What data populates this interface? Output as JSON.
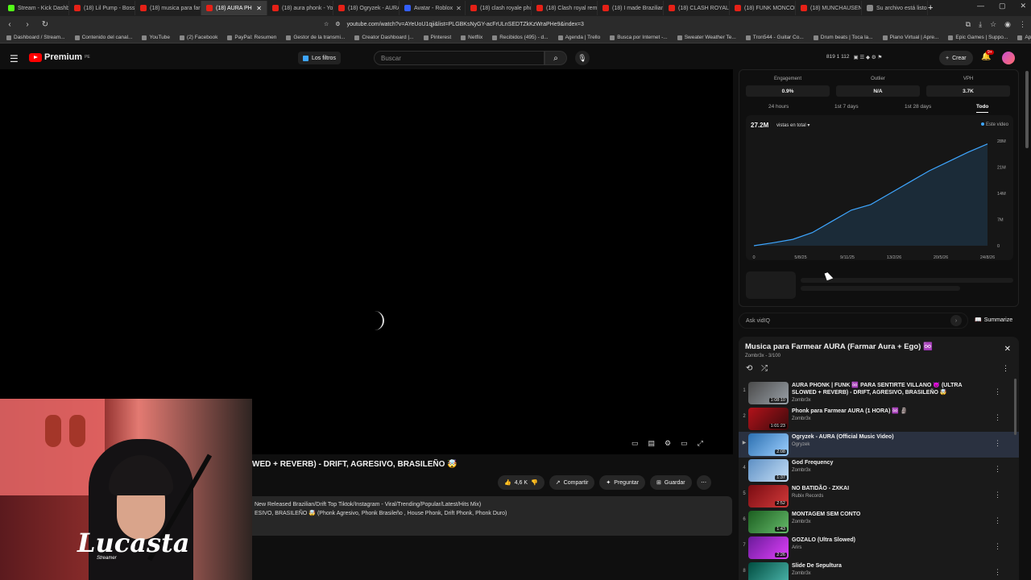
{
  "browser": {
    "tabs": [
      {
        "label": "Stream - Kick Dashbo",
        "kind": "k"
      },
      {
        "label": "(18) Lil Pump - Boss",
        "kind": "y"
      },
      {
        "label": "(18) musica para farm",
        "kind": "y"
      },
      {
        "label": "(18) AURA PH",
        "kind": "y",
        "active": true
      },
      {
        "label": "(18) aura phonk - You",
        "kind": "y"
      },
      {
        "label": "(18) Ogryzek - AURA",
        "kind": "y"
      },
      {
        "label": "Avatar - Roblox",
        "kind": "r"
      },
      {
        "label": "(18) clash royale pho",
        "kind": "y"
      },
      {
        "label": "(18) Clash royal remi",
        "kind": "y"
      },
      {
        "label": "(18) I made Brazilian",
        "kind": "y"
      },
      {
        "label": "(18) CLASH ROYALE F",
        "kind": "y"
      },
      {
        "label": "(18) FUNK MONCOLE",
        "kind": "y"
      },
      {
        "label": "(18) MUNCHAUSEN F",
        "kind": "y"
      },
      {
        "label": "Su archivo está listo!",
        "kind": "g"
      }
    ],
    "url": "youtube.com/watch?v=AYeUoU1qji&list=PLGBKsNyGY-acFrULnSEDTZkKzWraPHe9&index=3",
    "bookmarks": [
      "Dashboard / Stream...",
      "Contenido del canal...",
      "YouTube",
      "(2) Facebook",
      "PayPal: Resumen",
      "Gestor de la transmi...",
      "Creator Dashboard |...",
      "Pinterest",
      "Netflix",
      "Recibidos (495) - d...",
      "Agenda | Trello",
      "Busca por Internet -...",
      "Sweater Weather Te...",
      "Tron544 - Guitar Co...",
      "Drum beats | Toca la...",
      "Piano Virtual | Apre...",
      "Epic Games | Suppo...",
      "Apoya a un creador..."
    ]
  },
  "header": {
    "logo": "Premium",
    "logo_sup": "PE",
    "filters": "Los filtros",
    "search_placeholder": "Buscar",
    "stats": "819  1  112",
    "create": "Crear",
    "notif": "9+"
  },
  "video": {
    "title": "WED + REVERB) - DRIFT, AGRESIVO, BRASILEÑO 🤯",
    "likes": "4,6 K",
    "share": "Compartir",
    "ask": "Preguntar",
    "save": "Guardar",
    "desc_line1": "New Released Brazilian/Drift Top Tiktok/Instagram - Viral/Trending/Popular/Latest/Hits Mix)",
    "desc_line2": "ESIVO, BRASILEÑO 🤯 (Phonk Agresivo, Phonk Brasileño , House Phonk, Drift Phonk, Phonk Duro)"
  },
  "streamer": {
    "signature": "Lucasta",
    "sub": "Streamer"
  },
  "analytics": {
    "kpis": [
      {
        "label": "Engagement",
        "value": "0.9%"
      },
      {
        "label": "Outlier",
        "value": "N/A"
      },
      {
        "label": "VPH",
        "value": "3.7K"
      }
    ],
    "ranges": [
      "24 hours",
      "1st 7 days",
      "1st 28 days",
      "Todo"
    ],
    "selected_range": "Todo",
    "total": "27.2M",
    "total_label": "vistas en total",
    "legend": "Este video",
    "ask_placeholder": "Ask vidIQ",
    "summarize": "Summarize"
  },
  "chart_data": {
    "type": "area",
    "x_ticks": [
      "0",
      "5/8/25",
      "9/11/25",
      "13/2/26",
      "20/5/26",
      "24/8/26"
    ],
    "y_ticks": [
      "0",
      "7M",
      "14M",
      "21M",
      "28M"
    ],
    "ylim": [
      0,
      28
    ],
    "series": [
      {
        "name": "Este video",
        "color": "#3ea6ff",
        "values": [
          0,
          0.8,
          1.7,
          3.5,
          6.5,
          9.5,
          11.0,
          14.0,
          17.0,
          20.0,
          22.5,
          25.0,
          27.2
        ]
      }
    ]
  },
  "playlist": {
    "title": "Musica para Farmear AURA (Farmar Aura + Ego) ♾️",
    "sub": "Zombr3x - 3/100",
    "items": [
      {
        "idx": "1",
        "title": "AURA PHONK | FUNK ♾️ PARA SENTIRTE VILLANO 😈 (ULTRA SLOWED + REVERB) - DRIFT, AGRESIVO, BRASILEÑO 🤯",
        "channel": "Zombr3x",
        "dur": "1:08:10",
        "c1": "#4a4a4a",
        "c2": "#9aa1a8"
      },
      {
        "idx": "2",
        "title": "Phonk para Farmear AURA (1 HORA) ♾️ 🗿",
        "channel": "Zombr3x",
        "dur": "1:01:23",
        "c1": "#b3121a",
        "c2": "#3a0a0c"
      },
      {
        "idx": "▶",
        "title": "Ogryzek - AURA (Official Music Video)",
        "channel": "Ogryzek",
        "dur": "2:08",
        "c1": "#2b6fb0",
        "c2": "#9ed0ff",
        "cur": true
      },
      {
        "idx": "4",
        "title": "God Frequency",
        "channel": "Zombr3x",
        "dur": "1:37",
        "c1": "#5d8fc4",
        "c2": "#c7e0f7"
      },
      {
        "idx": "5",
        "title": "NO BATIDÃO - ZXKAI",
        "channel": "Rubix Records",
        "dur": "2:52",
        "c1": "#7a0c12",
        "c2": "#d23a3a"
      },
      {
        "idx": "6",
        "title": "MONTAGEM SEM CONTO",
        "channel": "Zombr3x",
        "dur": "1:43",
        "c1": "#1b5e20",
        "c2": "#66bb6a"
      },
      {
        "idx": "7",
        "title": "GOZALO (Ultra Slowed)",
        "channel": "Arirs",
        "dur": "2:26",
        "c1": "#6a1b9a",
        "c2": "#e040fb"
      },
      {
        "idx": "8",
        "title": "Slide De Sepultura",
        "channel": "Zombr3x",
        "dur": "",
        "c1": "#004d40",
        "c2": "#4db6ac"
      }
    ]
  }
}
